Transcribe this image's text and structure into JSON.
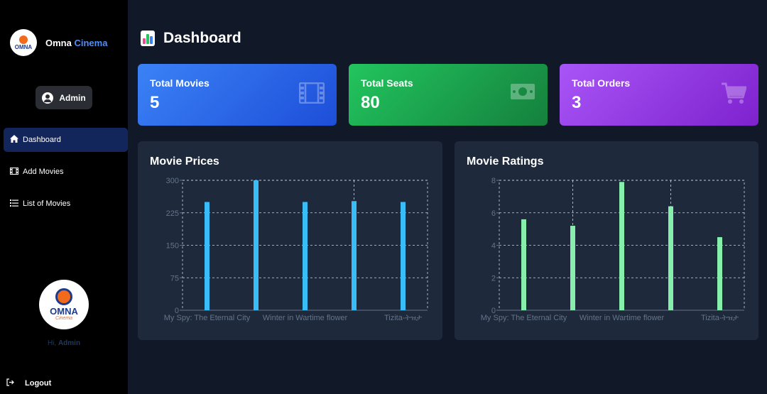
{
  "brand": {
    "name_a": "Omna",
    "name_b": "Cinema",
    "logo_text": "OMNA",
    "logo_sub": "Cinema"
  },
  "sidebar": {
    "admin_label": "Admin",
    "items": [
      {
        "label": "Dashboard",
        "icon": "home-icon"
      },
      {
        "label": "Add Movies",
        "icon": "film-icon"
      },
      {
        "label": "List of Movies",
        "icon": "list-icon"
      }
    ],
    "greeting_prefix": "Hi,",
    "greeting_name": "Admin",
    "logout": "Logout"
  },
  "page": {
    "title": "Dashboard"
  },
  "stats": [
    {
      "label": "Total Movies",
      "value": "5",
      "icon": "film-icon",
      "color": "#3b82f6"
    },
    {
      "label": "Total Seats",
      "value": "80",
      "icon": "money-icon",
      "color": "#22c55e"
    },
    {
      "label": "Total Orders",
      "value": "3",
      "icon": "cart-icon",
      "color": "#a855f7"
    }
  ],
  "chart_data": [
    {
      "type": "bar",
      "title": "Movie Prices",
      "categories": [
        "My Spy: The Eternal City",
        "",
        "Winter in Wartime flower",
        "",
        "Tizita-ትዝታ"
      ],
      "values": [
        250,
        310,
        250,
        252,
        250
      ],
      "ylim": [
        0,
        300
      ],
      "yticks": [
        0,
        75,
        150,
        225,
        300
      ],
      "color": "#38bdf8",
      "grid": true
    },
    {
      "type": "bar",
      "title": "Movie Ratings",
      "categories": [
        "My Spy: The Eternal City",
        "",
        "Winter in Wartime flower",
        "",
        "Tizita-ትዝታ"
      ],
      "values": [
        5.6,
        5.2,
        7.9,
        6.4,
        4.5
      ],
      "ylim": [
        0,
        8
      ],
      "yticks": [
        0,
        2,
        4,
        6,
        8
      ],
      "color": "#86efac",
      "grid": true
    }
  ]
}
